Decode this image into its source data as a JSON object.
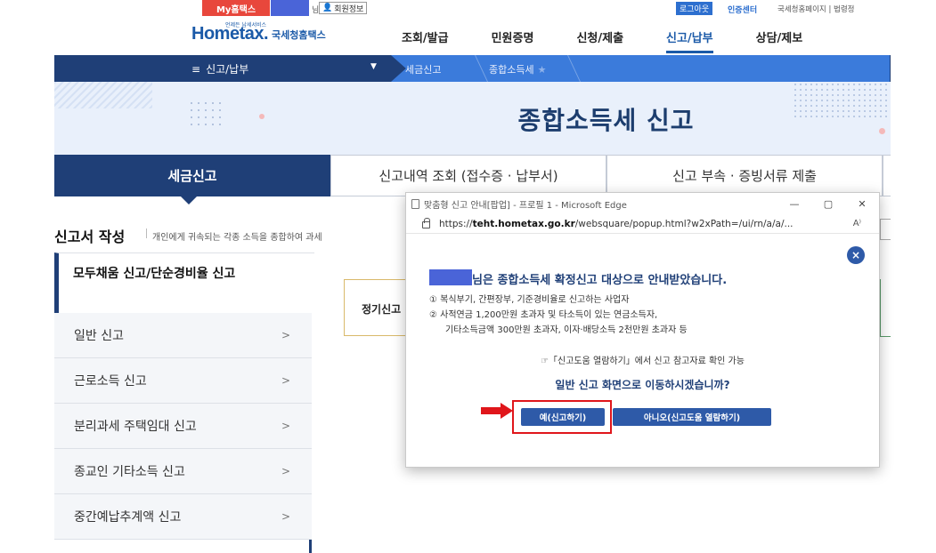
{
  "topbar": {
    "my_label": "My홈택스",
    "suffix": "님",
    "member_info": "회원정보",
    "logout": "로그아웃",
    "cert_center": "인증센터",
    "util_links": "국세청홈페이지 | 법령정"
  },
  "header": {
    "logo_small": "언제든 납세서비스",
    "logo_main": "Hometax.",
    "logo_sub": "국세청홈택스",
    "nav": [
      "조회/발급",
      "민원증명",
      "신청/제출",
      "신고/납부",
      "상담/제보"
    ],
    "nav_active_index": 3
  },
  "breadcrumb": {
    "menu_label": "신고/납부",
    "level2": "세금신고",
    "level3": "종합소득세"
  },
  "banner": {
    "title": "종합소득세 신고"
  },
  "tabs": [
    "세금신고",
    "신고내역 조회 (접수증 · 납부서)",
    "신고 부속 · 증빙서류 제출"
  ],
  "section": {
    "title": "신고서 작성",
    "desc": "개인에게 귀속되는 각종 소득을 종합하여 과세"
  },
  "left_menu": {
    "active": "모두채움 신고/단순경비율 신고",
    "items": [
      "일반 신고",
      "근로소득 신고",
      "분리과세 주택임대 신고",
      "종교인 기타소득 신고",
      "중간예납추계액 신고"
    ]
  },
  "content": {
    "label": "정기신고"
  },
  "popup": {
    "window_title": "맞춤형 신고 안내[팝업] - 프로필 1 - Microsoft Edge",
    "url_prefix": "https://",
    "url_domain": "teht.hometax.go.kr",
    "url_rest": "/websquare/popup.html?w2xPath=/ui/rn/a/a/...",
    "heading": "님은 종합소득세 확정신고 대상으로 안내받았습니다.",
    "line1": "① 복식부기, 간편장부, 기준경비율로 신고하는 사업자",
    "line2": "② 사적연금 1,200만원 초과자 및 타소득이 있는 연금소득자,",
    "line3": "기타소득금액 300만원 초과자, 이자·배당소득 2천만원 초과자 등",
    "hint": "☞「신고도움 열람하기」에서 신고 참고자료 확인 가능",
    "question": "일반 신고 화면으로 이동하시겠습니까?",
    "btn_yes": "예(신고하기)",
    "btn_no": "아니오(신고도움 열람하기)",
    "close_symbol": "×",
    "read_aloud": "A⁾"
  },
  "colors": {
    "navy": "#1f3f77",
    "brand_blue": "#1b5aa8",
    "button_blue": "#2e5aa8",
    "highlight_red": "#e0161b",
    "badge_red": "#e8473c"
  }
}
